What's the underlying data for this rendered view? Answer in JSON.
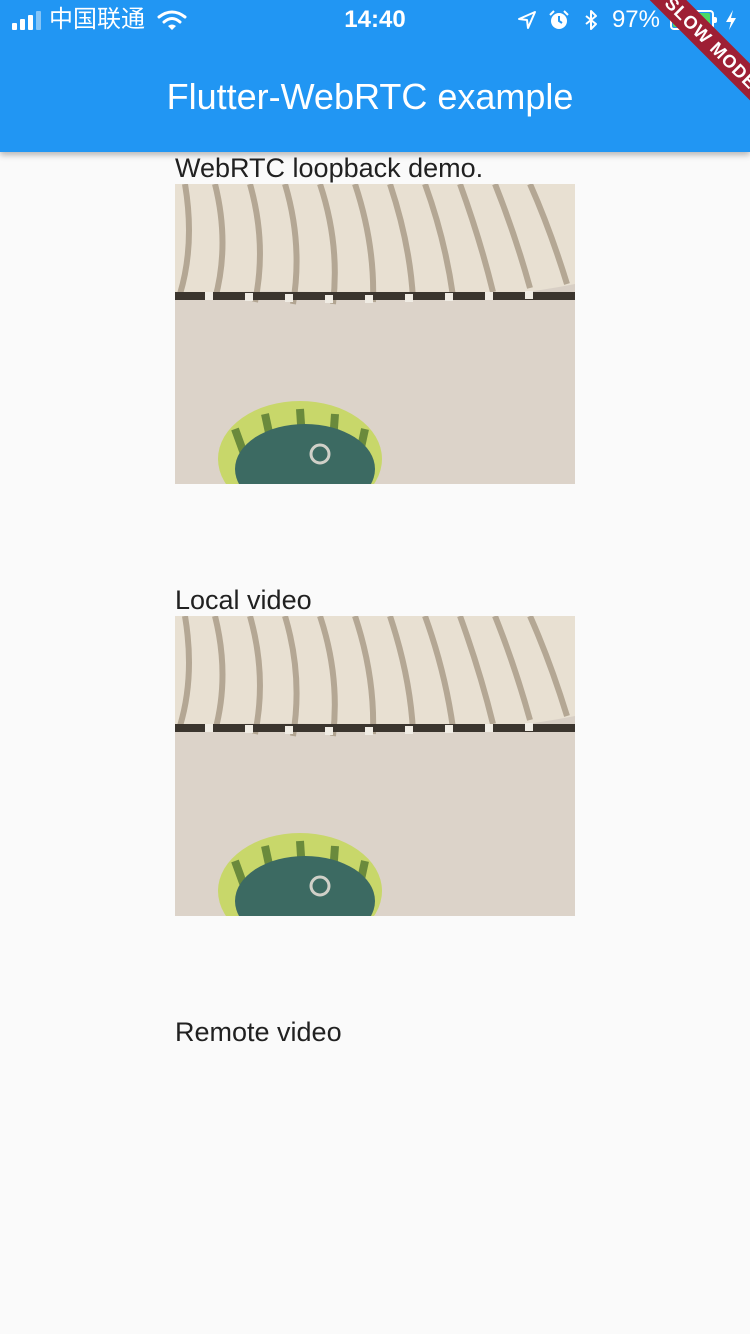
{
  "status_bar": {
    "carrier": "中国联通",
    "time": "14:40",
    "battery_percent": "97%",
    "battery_level": 0.97
  },
  "app_bar": {
    "title": "Flutter-WebRTC example",
    "background": "#2196f3"
  },
  "debug_banner": {
    "label": "SLOW MODE",
    "color": "#9e1f34"
  },
  "sections": {
    "demo_label": "WebRTC loopback demo.",
    "local_label": "Local video",
    "remote_label": "Remote video"
  },
  "icons": {
    "signal": "cellular-signal-icon",
    "wifi": "wifi-icon",
    "location": "location-arrow-icon",
    "alarm": "alarm-clock-icon",
    "bluetooth": "bluetooth-icon",
    "battery": "battery-icon",
    "charging": "charging-bolt-icon"
  }
}
